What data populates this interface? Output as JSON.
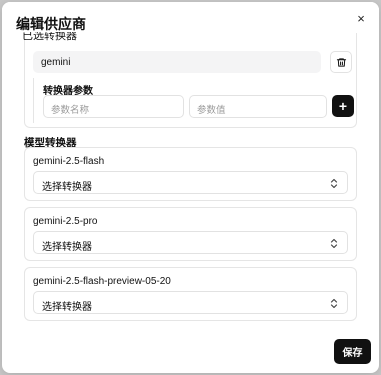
{
  "dialog": {
    "title": "编辑供应商",
    "close_label": "×",
    "cut_label": "已选转换器"
  },
  "transformer_entry": {
    "name_value": "gemini",
    "params_label": "转换器参数",
    "param_name_placeholder": "参数名称",
    "param_value_placeholder": "参数值",
    "add_label": "+"
  },
  "models_section": {
    "label": "模型转换器",
    "models": [
      {
        "name": "gemini-2.5-flash",
        "select_value": "选择转换器"
      },
      {
        "name": "gemini-2.5-pro",
        "select_value": "选择转换器"
      },
      {
        "name": "gemini-2.5-flash-preview-05-20",
        "select_value": "选择转换器"
      }
    ]
  },
  "footer": {
    "save_label": "保存"
  },
  "icons": {
    "trash": "trash-icon",
    "chevron": "chevron-up-down-icon",
    "close": "close-icon"
  }
}
